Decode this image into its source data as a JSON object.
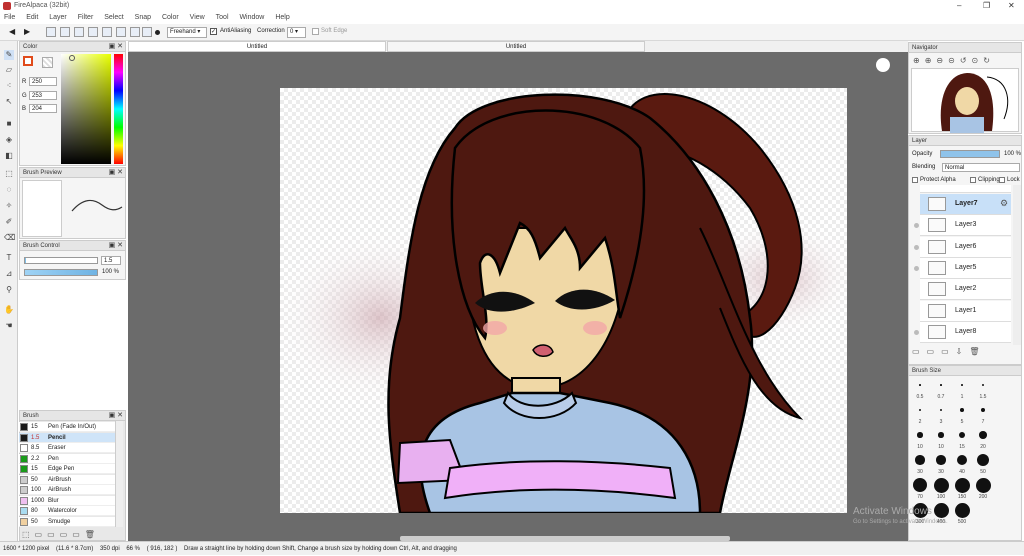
{
  "window": {
    "title": "FireAlpaca (32bit)"
  },
  "menu": [
    "File",
    "Edit",
    "Layer",
    "Filter",
    "Select",
    "Snap",
    "Color",
    "View",
    "Tool",
    "Window",
    "Help"
  ],
  "toolbar": {
    "mode": "Freehand",
    "antialiasing_label": "AntiAliasing",
    "correction_label": "Correction",
    "correction_value": "0",
    "soft_edge_label": "Soft Edge"
  },
  "tabs": [
    "Untitled",
    "Untitled"
  ],
  "color_panel": {
    "title": "Color",
    "r_label": "R",
    "r": "250",
    "g_label": "G",
    "g": "253",
    "b_label": "B",
    "b": "204",
    "accent": "#e04a1a"
  },
  "brush_preview": {
    "title": "Brush Preview"
  },
  "brush_control": {
    "title": "Brush Control",
    "size": "1.5",
    "opacity": "100 %"
  },
  "brush_panel": {
    "title": "Brush",
    "items": [
      {
        "size": "15",
        "name": "Pen (Fade In/Out)",
        "color": "#1a1a1a"
      },
      {
        "size": "1.5",
        "name": "Pencil",
        "color": "#1a1a1a",
        "selected": true
      },
      {
        "size": "8.5",
        "name": "Eraser",
        "color": "#ffffff"
      },
      {
        "size": "2.2",
        "name": "Pen",
        "color": "#1a9a1a"
      },
      {
        "size": "15",
        "name": "Edge Pen",
        "color": "#1a9a1a"
      },
      {
        "size": "50",
        "name": "AirBrush",
        "color": "#cccccc"
      },
      {
        "size": "100",
        "name": "AirBrush",
        "color": "#cccccc"
      },
      {
        "size": "1000",
        "name": "Blur",
        "color": "#f0c0f0"
      },
      {
        "size": "80",
        "name": "Watercolor",
        "color": "#aadcf0"
      },
      {
        "size": "50",
        "name": "Smudge",
        "color": "#f0d0a0"
      }
    ]
  },
  "navigator": {
    "title": "Navigator"
  },
  "layer_panel": {
    "title": "Layer",
    "opacity_label": "Opacity",
    "opacity": "100 %",
    "blending_label": "Blending",
    "blending": "Normal",
    "protect_alpha": "Protect Alpha",
    "clipping": "Clipping",
    "lock": "Lock",
    "layers": [
      "Layer7",
      "Layer3",
      "Layer6",
      "Layer5",
      "Layer2",
      "Layer1",
      "Layer8"
    ]
  },
  "brush_size": {
    "title": "Brush Size",
    "sizes": [
      "0.5",
      "0.7",
      "1",
      "1.5",
      "2",
      "3",
      "5",
      "7",
      "10",
      "10",
      "15",
      "20",
      "30",
      "30",
      "40",
      "50",
      "70",
      "100",
      "150",
      "200",
      "300",
      "400",
      "500"
    ]
  },
  "status": {
    "size": "1600 * 1200 pixel",
    "cm": "(11.6 * 8.7cm)",
    "dpi": "350 dpi",
    "zoom": "66 %",
    "coords": "( 916, 182 )",
    "hint": "Draw a straight line by holding down Shift, Change a brush size by holding down Ctrl, Alt, and dragging"
  },
  "watermark": {
    "line1": "Activate Windows",
    "line2": "Go to Settings to activate Windows."
  }
}
